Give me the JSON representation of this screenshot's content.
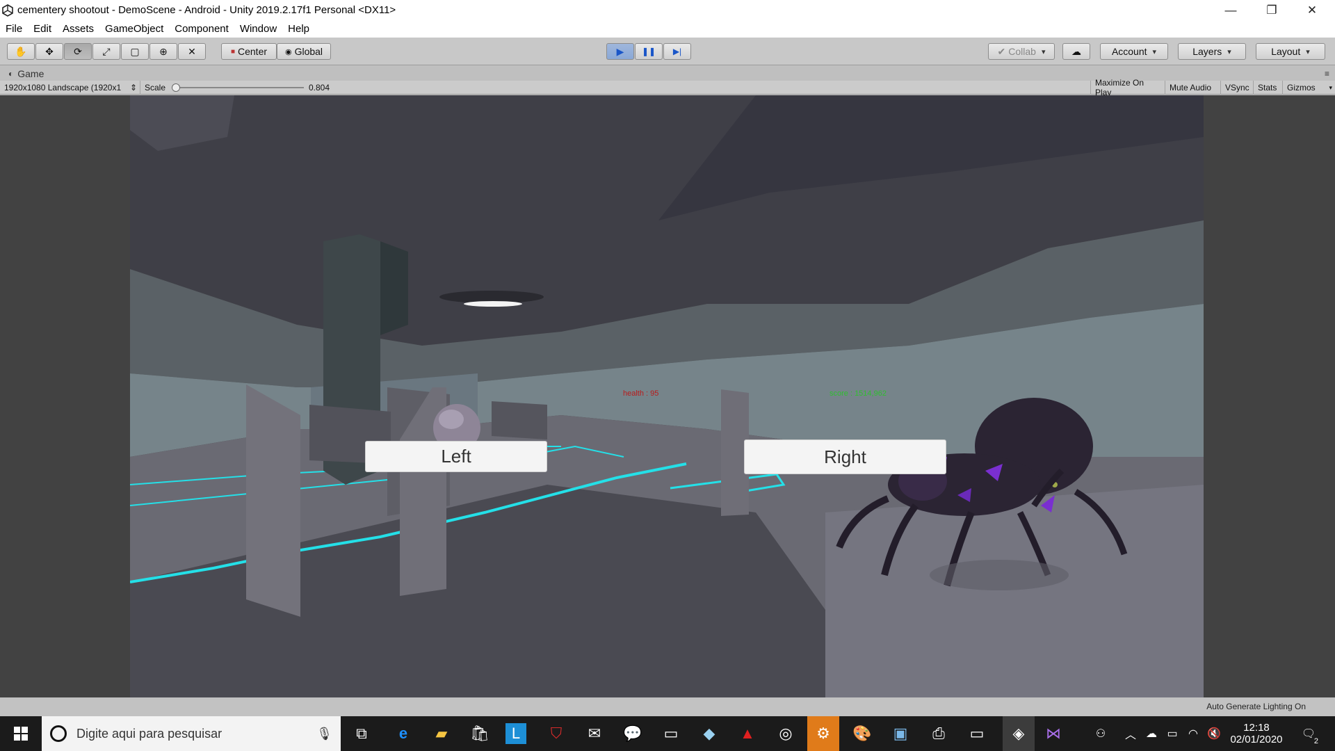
{
  "window": {
    "title": "cementery shootout - DemoScene - Android - Unity 2019.2.17f1 Personal <DX11>",
    "minimize_glyph": "—",
    "restore_glyph": "❐",
    "close_glyph": "✕"
  },
  "menu": [
    "File",
    "Edit",
    "Assets",
    "GameObject",
    "Component",
    "Window",
    "Help"
  ],
  "toolbar": {
    "tools": [
      "hand-tool",
      "move-tool",
      "rotate-tool",
      "scale-tool",
      "rect-tool",
      "transform-tool",
      "custom-tool"
    ],
    "tool_glyphs": [
      "✋",
      "✥",
      "⟳",
      "⤢",
      "▢",
      "⊕",
      "✕"
    ],
    "active_tool_index": 2,
    "pivot_mode": "Center",
    "pivot_rotation": "Global",
    "play_glyph": "▶",
    "pause_glyph": "❚❚",
    "step_glyph": "▶|",
    "collab": "Collab",
    "account": "Account",
    "layers": "Layers",
    "layout": "Layout"
  },
  "game_tab": {
    "label": "Game",
    "resolution": "1920x1080 Landscape (1920x1",
    "scale_label": "Scale",
    "scale_value": "0.804",
    "scale_fraction": 0.0,
    "options": [
      "Maximize On Play",
      "Mute Audio",
      "VSync",
      "Stats",
      "Gizmos"
    ]
  },
  "game_ui": {
    "left_button": "Left",
    "right_button": "Right",
    "score_text": "score : 1514,962",
    "health_text": "health : 95"
  },
  "status": {
    "lighting": "Auto Generate Lighting On"
  },
  "taskbar": {
    "search_placeholder": "Digite aqui para pesquisar",
    "time": "12:18",
    "date": "02/01/2020",
    "notification_count": "2",
    "apps": [
      "task-view",
      "edge",
      "file-explorer",
      "store",
      "l-app",
      "mcafee",
      "mail",
      "chat",
      "terminal",
      "notes",
      "acrobat",
      "obs",
      "steam",
      "paint",
      "photos",
      "printer",
      "console",
      "unity",
      "visual-studio"
    ]
  },
  "colors": {
    "accent_blue": "#0a58ca",
    "score_green": "#2fbf2f",
    "health_red": "#b71c1c",
    "neon_cyan": "#24e0e8",
    "spider_purple": "#7a2fd0"
  }
}
